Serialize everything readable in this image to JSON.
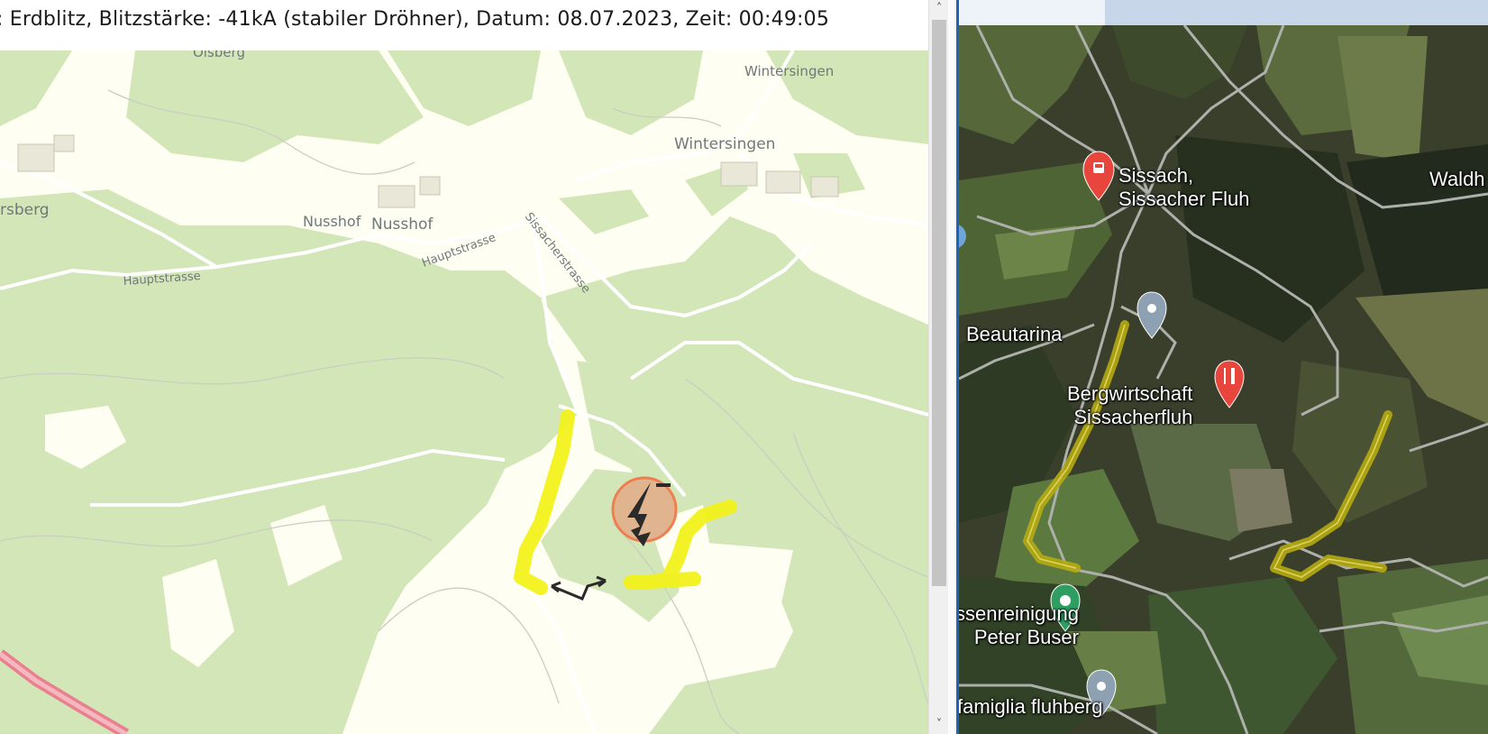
{
  "info_bar": {
    "text": ": Erdblitz, Blitzstärke: -41kA (stabiler Dröhner), Datum: 08.07.2023, Zeit: 00:49:05"
  },
  "street_map": {
    "place_labels": [
      "Olsberg",
      "Wintersingen",
      "Wintersingen",
      "rsberg",
      "Nusshof",
      "Nusshof"
    ],
    "street_labels": [
      "Hauptstrasse",
      "Hauptstrasse",
      "Sissacherstrasse"
    ],
    "colors": {
      "background": "#fffef2",
      "forest": "#d3e6b8",
      "road": "#ffffff",
      "highway": "#e8808e",
      "highlight": "#f2f21c",
      "strike_marker": "#e0b48e"
    },
    "icons": [
      "lightning-strike-icon",
      "lightning-arrow-icon"
    ]
  },
  "satellite_map": {
    "pois": {
      "sissach": {
        "line1": "Sissach,",
        "line2": "Sissacher Fluh",
        "icon": "train-station-icon"
      },
      "beautarina": {
        "line1": "Beautarina",
        "icon": "location-pin-icon"
      },
      "bergwirtschaft": {
        "line1": "Bergwirtschaft",
        "line2": "Sissacherfluh",
        "icon": "restaurant-icon"
      },
      "waldh": {
        "line1": "Waldh"
      },
      "reinigung": {
        "line1": "ssenreinigung",
        "line2": "Peter Buser",
        "icon": "laundry-icon"
      },
      "famiglia": {
        "line1": "famiglia fluhberg",
        "icon": "location-pin-icon"
      }
    },
    "colors": {
      "poi_red": "#e8453c",
      "poi_grey": "#8ea1b3",
      "poi_green": "#2e9e62",
      "path_highlight": "#b5aa12"
    }
  },
  "scrollbar": {
    "up_arrow": "˄",
    "down_arrow": "˅"
  }
}
